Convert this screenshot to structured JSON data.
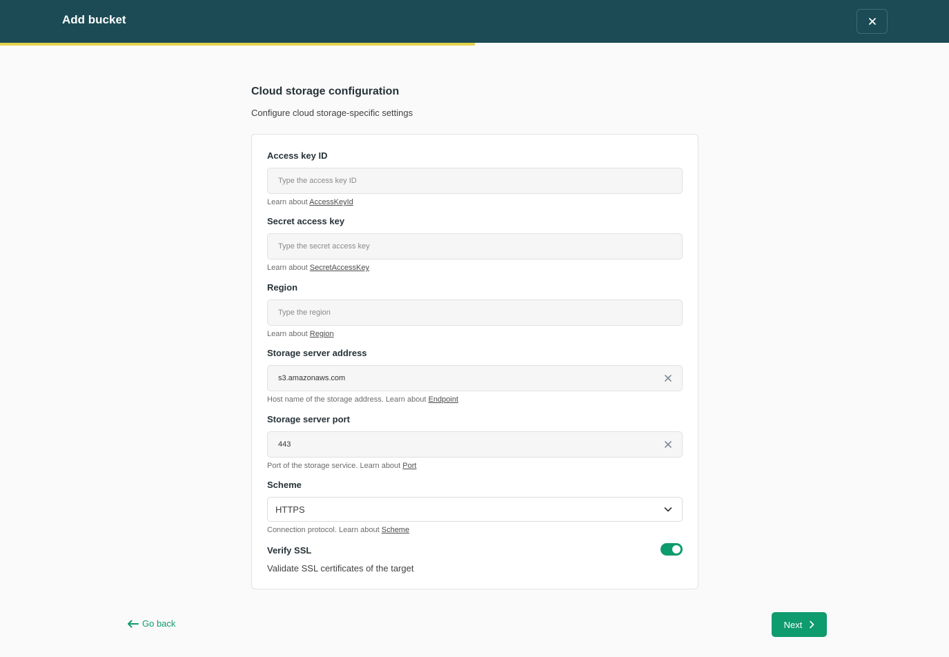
{
  "header": {
    "title": "Add bucket",
    "close_icon": "close-icon",
    "progress": 0.5,
    "progress_color": "#e3d24a",
    "bg_color": "#1c4b55"
  },
  "section": {
    "title": "Cloud storage configuration",
    "subtitle": "Configure cloud storage-specific settings"
  },
  "fields": {
    "access_key": {
      "label": "Access key ID",
      "placeholder": "Type the access key ID",
      "value": "",
      "help_prefix": "Learn about ",
      "help_link": "AccessKeyId"
    },
    "secret_key": {
      "label": "Secret access key",
      "placeholder": "Type the secret access key",
      "value": "",
      "help_prefix": "Learn about ",
      "help_link": "SecretAccessKey"
    },
    "region": {
      "label": "Region",
      "placeholder": "Type the region",
      "value": "",
      "help_prefix": "Learn about ",
      "help_link": "Region"
    },
    "server_address": {
      "label": "Storage server address",
      "value": "s3.amazonaws.com",
      "help_prefix": "Host name of the storage address. Learn about ",
      "help_link": "Endpoint"
    },
    "server_port": {
      "label": "Storage server port",
      "value": "443",
      "help_prefix": "Port of the storage service. Learn about ",
      "help_link": "Port"
    },
    "scheme": {
      "label": "Scheme",
      "value": "HTTPS",
      "help_prefix": "Connection protocol. Learn about ",
      "help_link": "Scheme"
    },
    "verify_ssl": {
      "label": "Verify SSL",
      "enabled": true,
      "description": "Validate SSL certificates of the target"
    }
  },
  "footer": {
    "back_label": "Go back",
    "next_label": "Next",
    "accent_color": "#0e9b6d"
  }
}
